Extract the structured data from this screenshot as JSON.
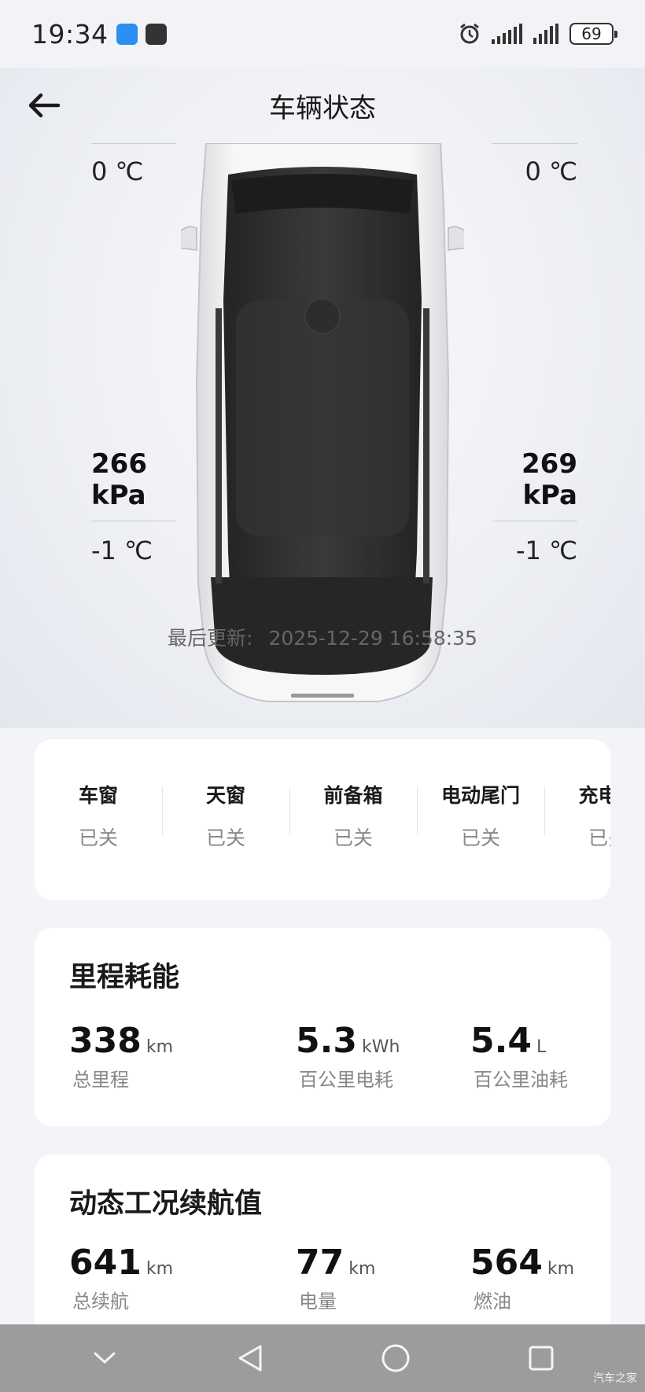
{
  "status_bar": {
    "time": "19:34",
    "battery": "69",
    "icons": [
      "message-app-icon",
      "vehicle-app-icon",
      "alarm-icon",
      "signal-icon",
      "signal-icon",
      "battery-icon"
    ]
  },
  "header": {
    "title": "车辆状态",
    "back_icon": "arrow-left-icon"
  },
  "tires": {
    "front_left": {
      "temp": "0 ℃"
    },
    "front_right": {
      "temp": "0 ℃"
    },
    "rear_left": {
      "pressure": "266 kPa",
      "temp": "-1 ℃"
    },
    "rear_right": {
      "pressure": "269 kPa",
      "temp": "-1 ℃"
    }
  },
  "last_updated": {
    "label": "最后更新:",
    "value": "2025-12-29 16:58:35"
  },
  "openings": [
    {
      "label": "车窗",
      "status": "已关"
    },
    {
      "label": "天窗",
      "status": "已关"
    },
    {
      "label": "前备箱",
      "status": "已关"
    },
    {
      "label": "电动尾门",
      "status": "已关"
    },
    {
      "label": "充电口",
      "status": "已关"
    }
  ],
  "mileage": {
    "title": "里程耗能",
    "items": [
      {
        "value": "338",
        "unit": "km",
        "label": "总里程"
      },
      {
        "value": "5.3",
        "unit": "kWh",
        "label": "百公里电耗"
      },
      {
        "value": "5.4",
        "unit": "L",
        "label": "百公里油耗"
      }
    ]
  },
  "range": {
    "title": "动态工况续航值",
    "items": [
      {
        "value": "641",
        "unit": "km",
        "label": "总续航"
      },
      {
        "value": "77",
        "unit": "km",
        "label": "电量"
      },
      {
        "value": "564",
        "unit": "km",
        "label": "燃油"
      }
    ]
  },
  "nav_bar": {
    "buttons": [
      "chevron-down-icon",
      "back-triangle-icon",
      "home-circle-icon",
      "recents-square-icon"
    ]
  },
  "watermark": "汽车之家"
}
